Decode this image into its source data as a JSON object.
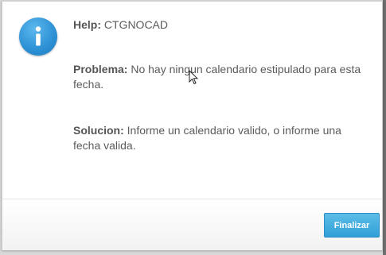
{
  "dialog": {
    "help_label": "Help:",
    "help_code": "CTGNOCAD",
    "problema_label": "Problema:",
    "problema_text": "No hay ningun calendario estipulado para esta fecha.",
    "solucion_label": "Solucion:",
    "solucion_text": "Informe un calendario valido, o informe una fecha valida.",
    "icon": "info-icon",
    "accent_color": "#2f93d6"
  },
  "footer": {
    "finalizar_label": "Finalizar"
  }
}
